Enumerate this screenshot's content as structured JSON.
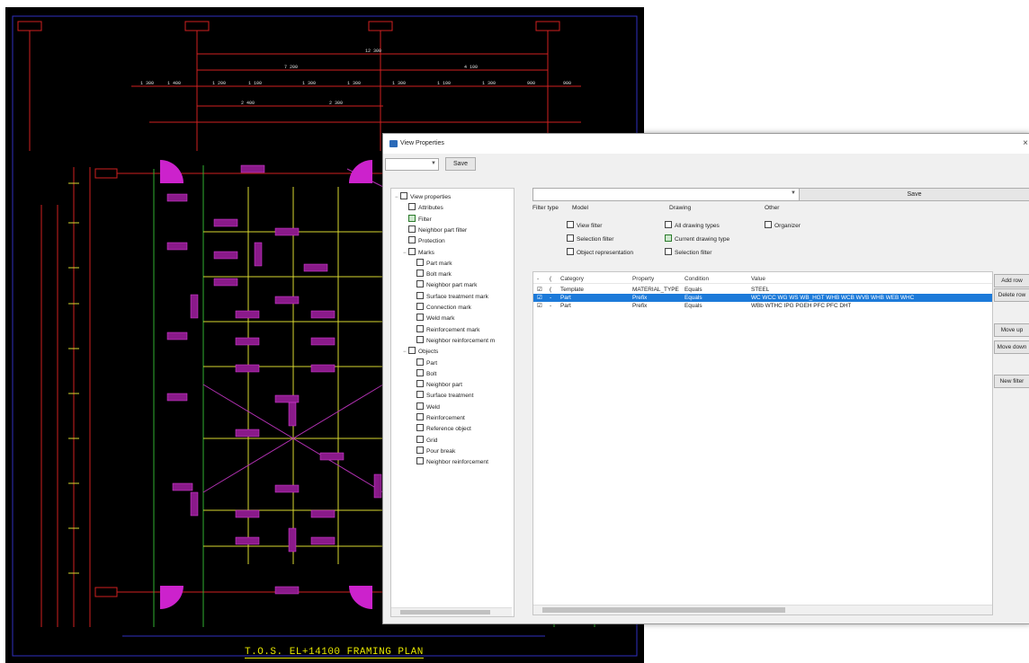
{
  "cad": {
    "drawing_title": "T.O.S. EL+14100 FRAMING PLAN"
  },
  "dialog": {
    "title": "View Properties",
    "close_glyph": "×",
    "top_save": "Save",
    "filter_save": "Save",
    "tree": [
      {
        "label": "View properties",
        "level": 0,
        "checked": false,
        "expander": "−"
      },
      {
        "label": "Attributes",
        "level": 1,
        "checked": false
      },
      {
        "label": "Filter",
        "level": 1,
        "checked": true
      },
      {
        "label": "Neighbor part filter",
        "level": 1,
        "checked": false
      },
      {
        "label": "Protection",
        "level": 1,
        "checked": false
      },
      {
        "label": "Marks",
        "level": 1,
        "checked": false,
        "expander": "−"
      },
      {
        "label": "Part mark",
        "level": 2,
        "checked": false
      },
      {
        "label": "Bolt mark",
        "level": 2,
        "checked": false
      },
      {
        "label": "Neighbor part mark",
        "level": 2,
        "checked": false
      },
      {
        "label": "Surface treatment mark",
        "level": 2,
        "checked": false
      },
      {
        "label": "Connection mark",
        "level": 2,
        "checked": false
      },
      {
        "label": "Weld mark",
        "level": 2,
        "checked": false
      },
      {
        "label": "Reinforcement mark",
        "level": 2,
        "checked": false
      },
      {
        "label": "Neighbor reinforcement m",
        "level": 2,
        "checked": false
      },
      {
        "label": "Objects",
        "level": 1,
        "checked": false,
        "expander": "−"
      },
      {
        "label": "Part",
        "level": 2,
        "checked": false
      },
      {
        "label": "Bolt",
        "level": 2,
        "checked": false
      },
      {
        "label": "Neighbor part",
        "level": 2,
        "checked": false
      },
      {
        "label": "Surface treatment",
        "level": 2,
        "checked": false
      },
      {
        "label": "Weld",
        "level": 2,
        "checked": false
      },
      {
        "label": "Reinforcement",
        "level": 2,
        "checked": false
      },
      {
        "label": "Reference object",
        "level": 2,
        "checked": false
      },
      {
        "label": "Grid",
        "level": 2,
        "checked": false
      },
      {
        "label": "Pour break",
        "level": 2,
        "checked": false
      },
      {
        "label": "Neighbor reinforcement",
        "level": 2,
        "checked": false
      }
    ],
    "filter_type_label": "Filter type",
    "model_label": "Model",
    "drawing_label": "Drawing",
    "other_label": "Other",
    "model_checks": [
      {
        "label": "View filter",
        "checked": false
      },
      {
        "label": "Selection filter",
        "checked": false
      },
      {
        "label": "Object representation",
        "checked": false
      }
    ],
    "drawing_checks": [
      {
        "label": "All drawing types",
        "checked": false
      },
      {
        "label": "Current drawing type",
        "checked": true
      },
      {
        "label": "Selection filter",
        "checked": false
      }
    ],
    "other_checks": [
      {
        "label": "Organizer",
        "checked": false
      }
    ],
    "grid": {
      "headers": [
        "-",
        "(",
        "Category",
        "Property",
        "Condition",
        "Value"
      ],
      "rows": [
        {
          "c0": "☑",
          "c1": "(",
          "category": "Template",
          "property": "MATERIAL_TYPE",
          "condition": "Equals",
          "value": "STEEL",
          "selected": false
        },
        {
          "c0": "☑",
          "c1": "-",
          "category": "Part",
          "property": "Prefix",
          "condition": "Equals",
          "value": "WC WCC WG WS WB_HGT WHB WCB WVB WHB WEB WHC",
          "selected": true
        },
        {
          "c0": "☑",
          "c1": "-",
          "category": "Part",
          "property": "Prefix",
          "condition": "Equals",
          "value": "WBb WTHC IPG PGEH PFC PFC DHT",
          "selected": false
        }
      ]
    },
    "side_buttons": [
      "Add row",
      "Delete row",
      "Move up",
      "Move down",
      "New filter"
    ]
  }
}
